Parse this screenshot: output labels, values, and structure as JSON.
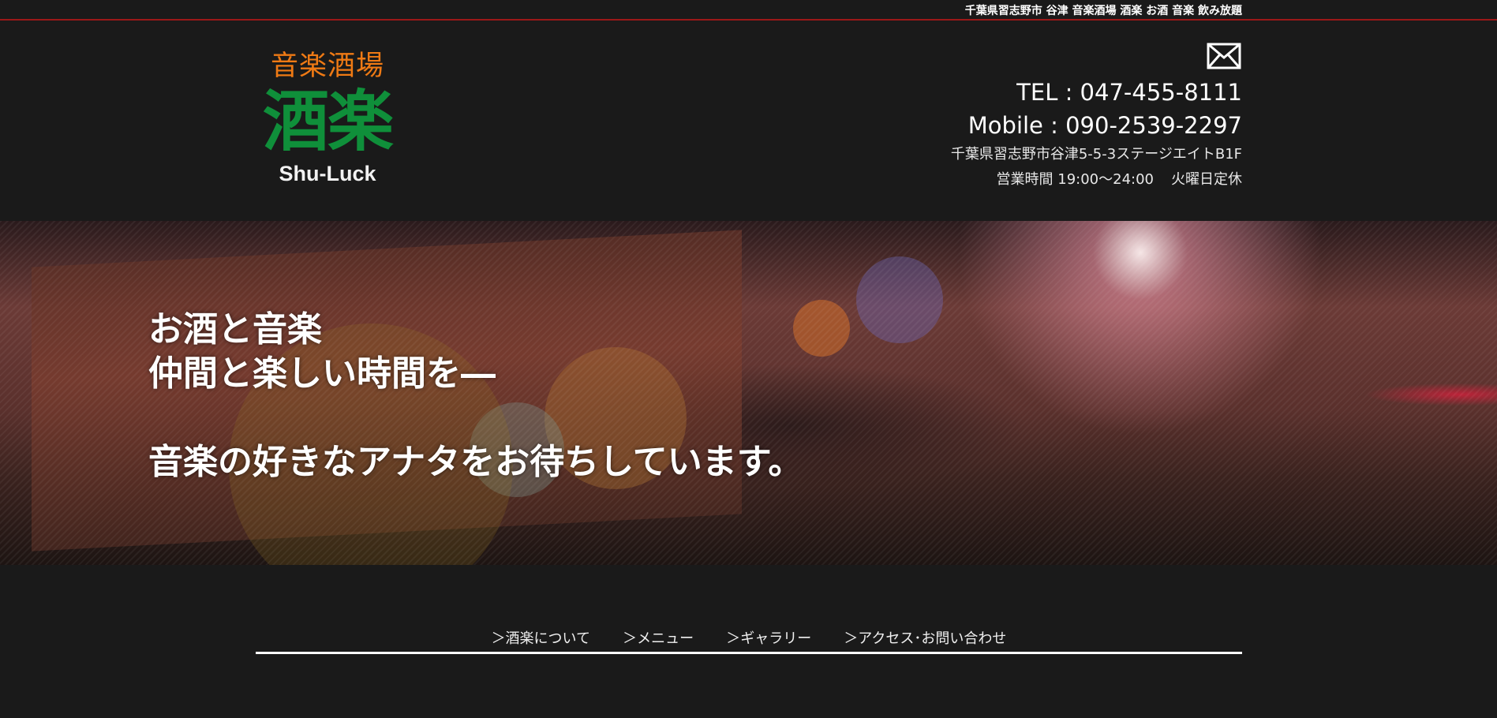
{
  "header": {
    "tagline": "千葉県習志野市 谷津 音楽酒場 酒楽 お酒 音楽 飲み放題"
  },
  "logo": {
    "sub": "音楽酒場",
    "main": "酒楽",
    "en": "Shu-Luck"
  },
  "contact": {
    "mail_icon": "envelope-icon",
    "tel": "TEL : 047-455-8111",
    "mobile": "Mobile : 090-2539-2297",
    "address": "千葉県習志野市谷津5-5-3ステージエイトB1F",
    "hours": "営業時間 19:00～24:00",
    "closed": "火曜日定休"
  },
  "hero": {
    "line1": "お酒と音楽",
    "line2": "仲間と楽しい時間を―",
    "line3": "音楽の好きなアナタをお待ちしています。"
  },
  "nav": {
    "items": [
      "＞酒楽について",
      "＞メニュー",
      "＞ギャラリー",
      "＞アクセス･お問い合わせ"
    ]
  },
  "colors": {
    "background": "#1a1a1a",
    "top_border": "#9c1818",
    "logo_orange": "#ef7a14",
    "logo_green": "#0f8f3a"
  }
}
